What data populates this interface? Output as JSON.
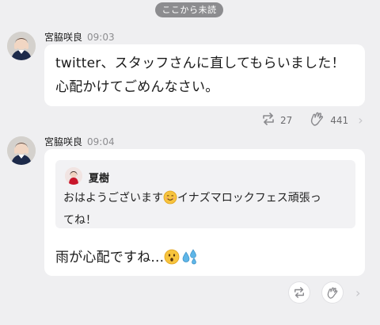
{
  "unread_divider": "ここから未読",
  "messages": [
    {
      "sender": "宮脇咲良",
      "time": "09:03",
      "text_line1": "twitter、スタッフさんに直してもらいました！",
      "text_line2": "心配かけてごめんなさい。",
      "reactions": {
        "repost_count": "27",
        "clap_count": "441"
      }
    },
    {
      "sender": "宮脇咲良",
      "time": "09:04",
      "quote": {
        "author": "夏樹",
        "text_before_emoji": "おはようございます",
        "text_after_emoji": "イナズマロックフェス頑張っ",
        "text_line2": "てね！",
        "emoji_icon": "smiling-face-icon"
      },
      "text": "雨が心配ですね...",
      "text_emojis": [
        "astonished-face-icon",
        "sweat-droplets-icon"
      ]
    }
  ],
  "colors": {
    "background": "#efeff1",
    "bubble": "#ffffff",
    "divider_pill": "#8c8c8f",
    "meta_text": "#8d8d90"
  }
}
